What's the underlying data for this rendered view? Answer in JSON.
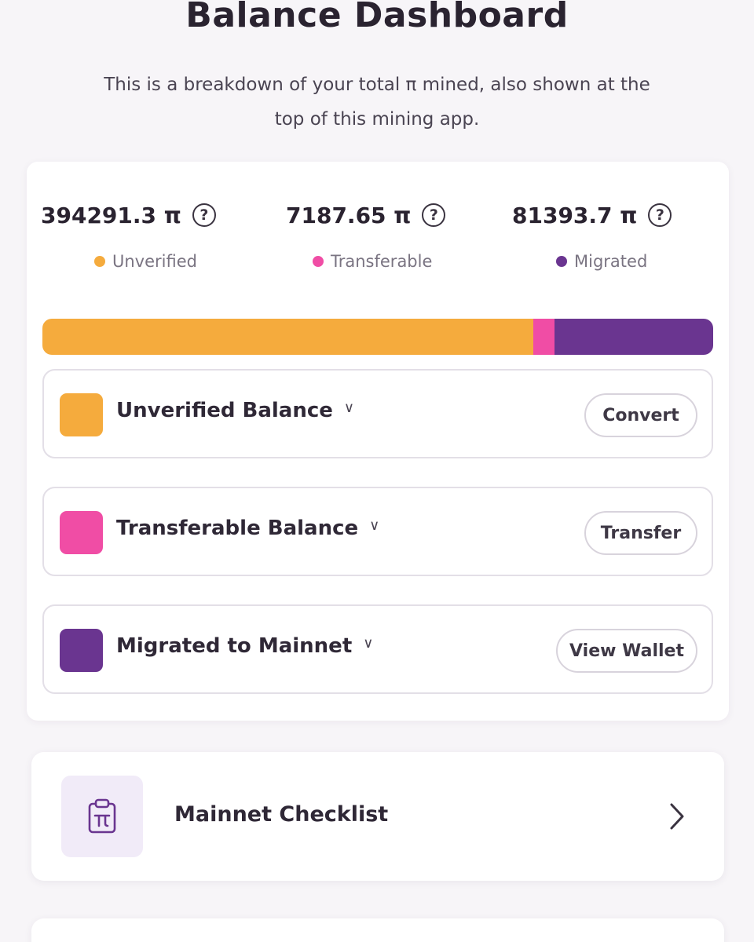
{
  "header": {
    "title": "Balance Dashboard",
    "subtitle_line1": "This is a breakdown of your total π mined, also shown at the",
    "subtitle_line2": "top of this mining app."
  },
  "stats": [
    {
      "value": "394291.3 π",
      "label": "Unverified",
      "color": "#f5ab3d"
    },
    {
      "value": "7187.65 π",
      "label": "Transferable",
      "color": "#f04da5"
    },
    {
      "value": "81393.7 π",
      "label": "Migrated",
      "color": "#6a3590"
    }
  ],
  "help_glyph": "?",
  "balance_bar": {
    "segments": [
      {
        "name": "Unverified",
        "fraction": 0.7318,
        "color": "#f5ab3d"
      },
      {
        "name": "Transferable",
        "fraction": 0.0321,
        "color": "#f04da5"
      },
      {
        "name": "Migrated",
        "fraction": 0.2361,
        "color": "#6a3590"
      }
    ]
  },
  "balance_rows": [
    {
      "label": "Unverified Balance",
      "action": "Convert",
      "color": "#f5ab3d"
    },
    {
      "label": "Transferable Balance",
      "action": "Transfer",
      "color": "#f04da5"
    },
    {
      "label": "Migrated to Mainnet",
      "action": "View Wallet",
      "color": "#6a3590"
    }
  ],
  "checklist": {
    "label": "Mainnet Checklist",
    "icon": "clipboard-pi-icon"
  }
}
